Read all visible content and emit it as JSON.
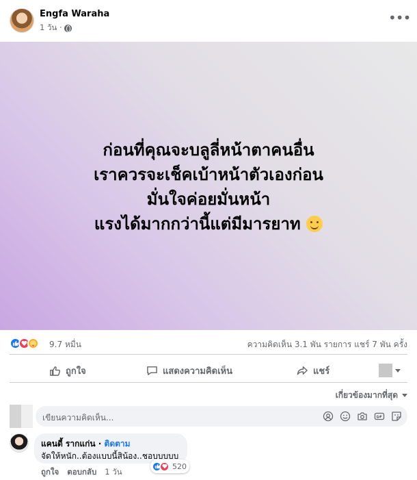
{
  "post": {
    "author": "Engfa Waraha",
    "time": "1 วัน ·",
    "more_label": "•••"
  },
  "banner": {
    "lines": [
      "ก่อนที่คุณจะบลูลี่หน้าตาคนอื่น",
      "เราควรจะเช็คเบ้าหน้าตัวเองก่อน",
      "มั่นใจค่อยมั่นหน้า",
      "แรงได้มากกว่านี้แต่มีมารยาท"
    ]
  },
  "stats": {
    "reaction_count": "9.7 หมื่น",
    "comments_shares": "ความคิดเห็น 3.1 พัน รายการ   แชร์ 7 พัน ครั้ง"
  },
  "actions": {
    "like": "ถูกใจ",
    "comment": "แสดงความคิดเห็น",
    "share": "แชร์"
  },
  "comments": {
    "sort_label": "เกี่ยวข้องมากที่สุด",
    "composer_placeholder": "เขียนความคิดเห็น...",
    "items": [
      {
        "name": "แคนดี้ รากแก่น",
        "follow": "ติดตาม",
        "text": "จัดให้หนัก..ต้องแบบนี้สิน้อง..ชอบบบบบ",
        "like": "ถูกใจ",
        "reply": "ตอบกลับ",
        "time": "1 วัน",
        "reaction_count": "520"
      }
    ]
  },
  "colors": {
    "accent": "#1877f2",
    "secondary_text": "#65676b",
    "love": "#f33e58",
    "care": "#f7b125"
  }
}
